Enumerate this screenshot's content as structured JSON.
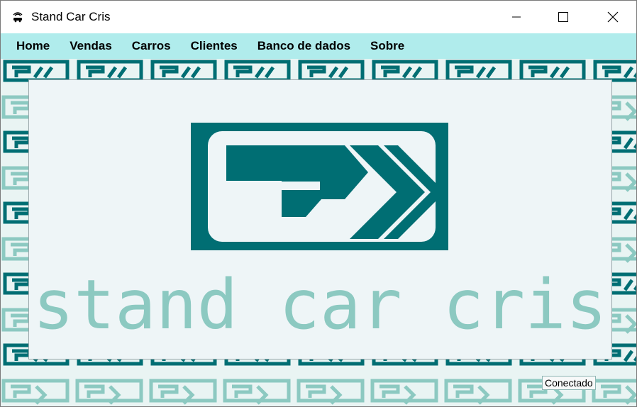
{
  "window": {
    "title": "Stand Car Cris",
    "app_icon": "car-icon",
    "controls": {
      "minimize": "minimize-icon",
      "maximize": "maximize-icon",
      "close": "close-icon"
    }
  },
  "menu": {
    "items": [
      {
        "label": "Home"
      },
      {
        "label": "Vendas"
      },
      {
        "label": "Carros"
      },
      {
        "label": "Clientes"
      },
      {
        "label": "Banco de dados"
      },
      {
        "label": "Sobre"
      }
    ]
  },
  "logo": {
    "text": "stand car cris",
    "primary_color": "#006e73",
    "secondary_color": "#8cc9c1"
  },
  "status": {
    "text": "Conectado"
  },
  "colors": {
    "menubar": "#b0ecec",
    "pattern_dark": "#006e73",
    "pattern_light": "#8cc9c1",
    "panel": "#eef5f7"
  }
}
